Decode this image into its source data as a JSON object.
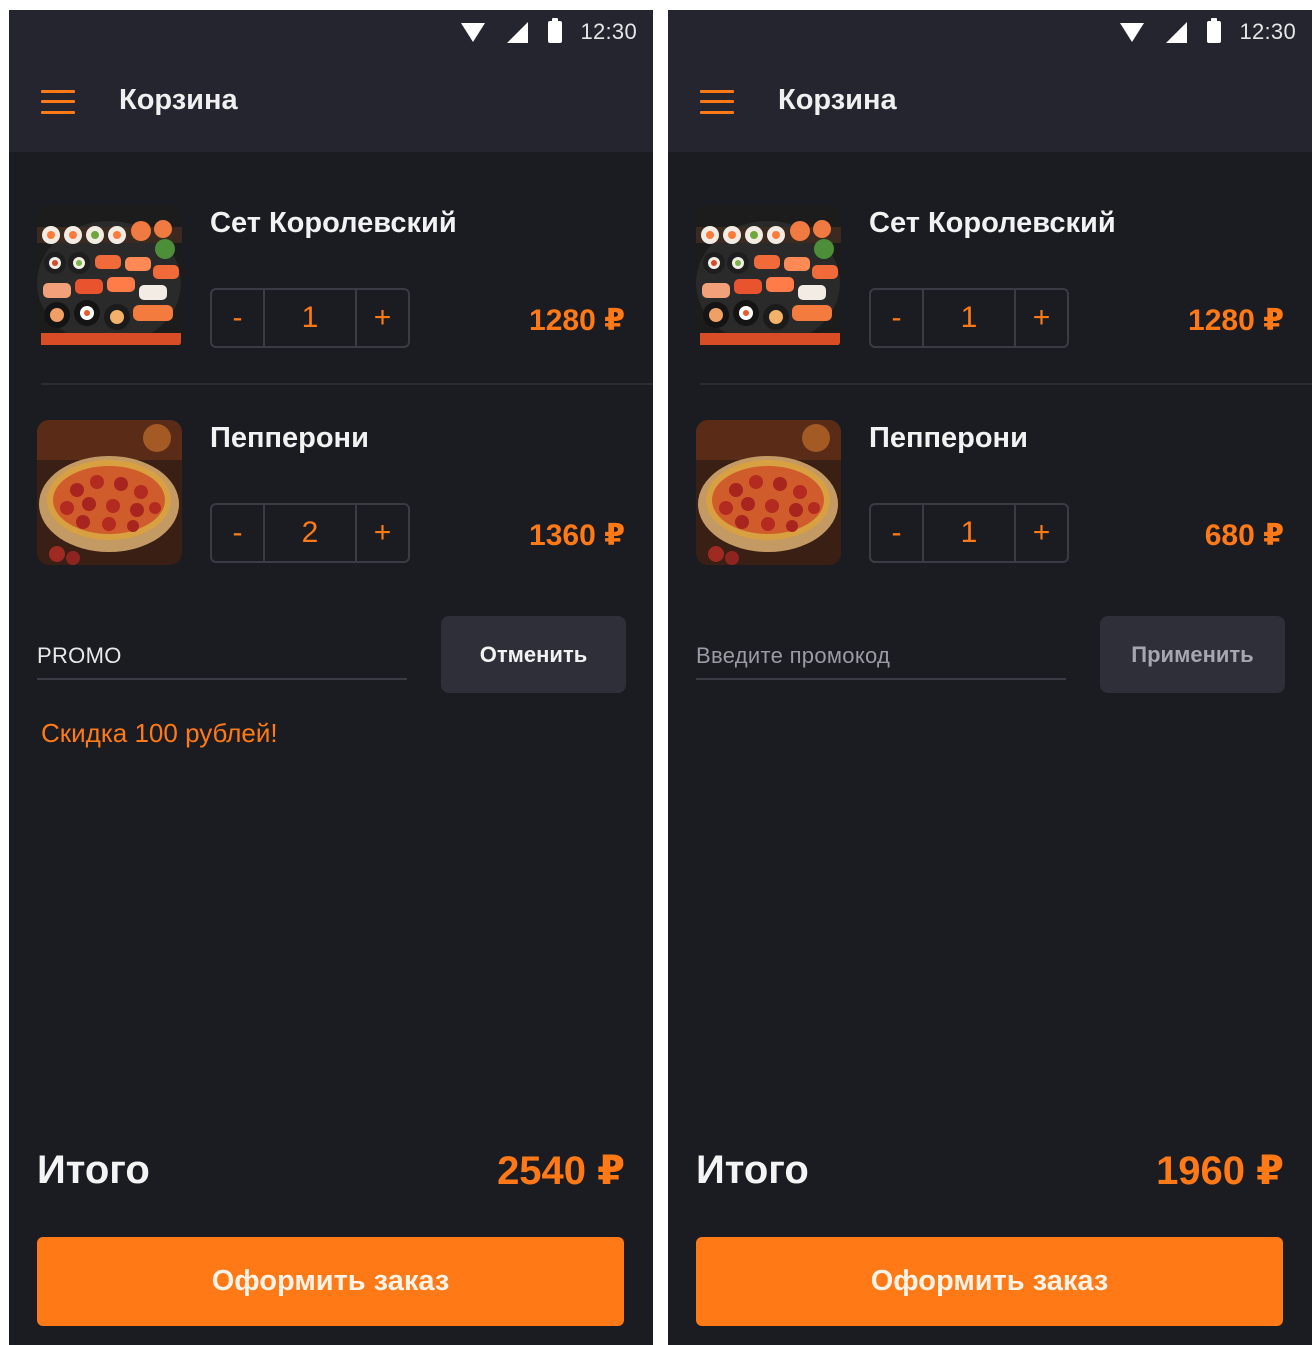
{
  "colors": {
    "accent": "#ff7a16",
    "background": "#1b1c22",
    "topbar": "#24252e",
    "button_secondary": "#2e2f38"
  },
  "screens": [
    {
      "status_time": "12:30",
      "app_title": "Корзина",
      "items": [
        {
          "name": "Сет Королевский",
          "quantity": "1",
          "price": "1280 ₽",
          "image": "sushi-set-image",
          "dec_label": "-",
          "inc_label": "+"
        },
        {
          "name": "Пепперони",
          "quantity": "2",
          "price": "1360 ₽",
          "image": "pepperoni-pizza-image",
          "dec_label": "-",
          "inc_label": "+"
        }
      ],
      "promo": {
        "value": "PROMO",
        "placeholder": "",
        "button_label": "Отменить",
        "message": "Скидка 100 рублей!"
      },
      "total": {
        "label": "Итого",
        "value": "2540 ₽"
      },
      "checkout_label": "Оформить заказ"
    },
    {
      "status_time": "12:30",
      "app_title": "Корзина",
      "items": [
        {
          "name": "Сет Королевский",
          "quantity": "1",
          "price": "1280 ₽",
          "image": "sushi-set-image",
          "dec_label": "-",
          "inc_label": "+"
        },
        {
          "name": "Пепперони",
          "quantity": "1",
          "price": "680 ₽",
          "image": "pepperoni-pizza-image",
          "dec_label": "-",
          "inc_label": "+"
        }
      ],
      "promo": {
        "value": "",
        "placeholder": "Введите промокод",
        "button_label": "Применить",
        "message": ""
      },
      "total": {
        "label": "Итого",
        "value": "1960 ₽"
      },
      "checkout_label": "Оформить заказ"
    }
  ]
}
